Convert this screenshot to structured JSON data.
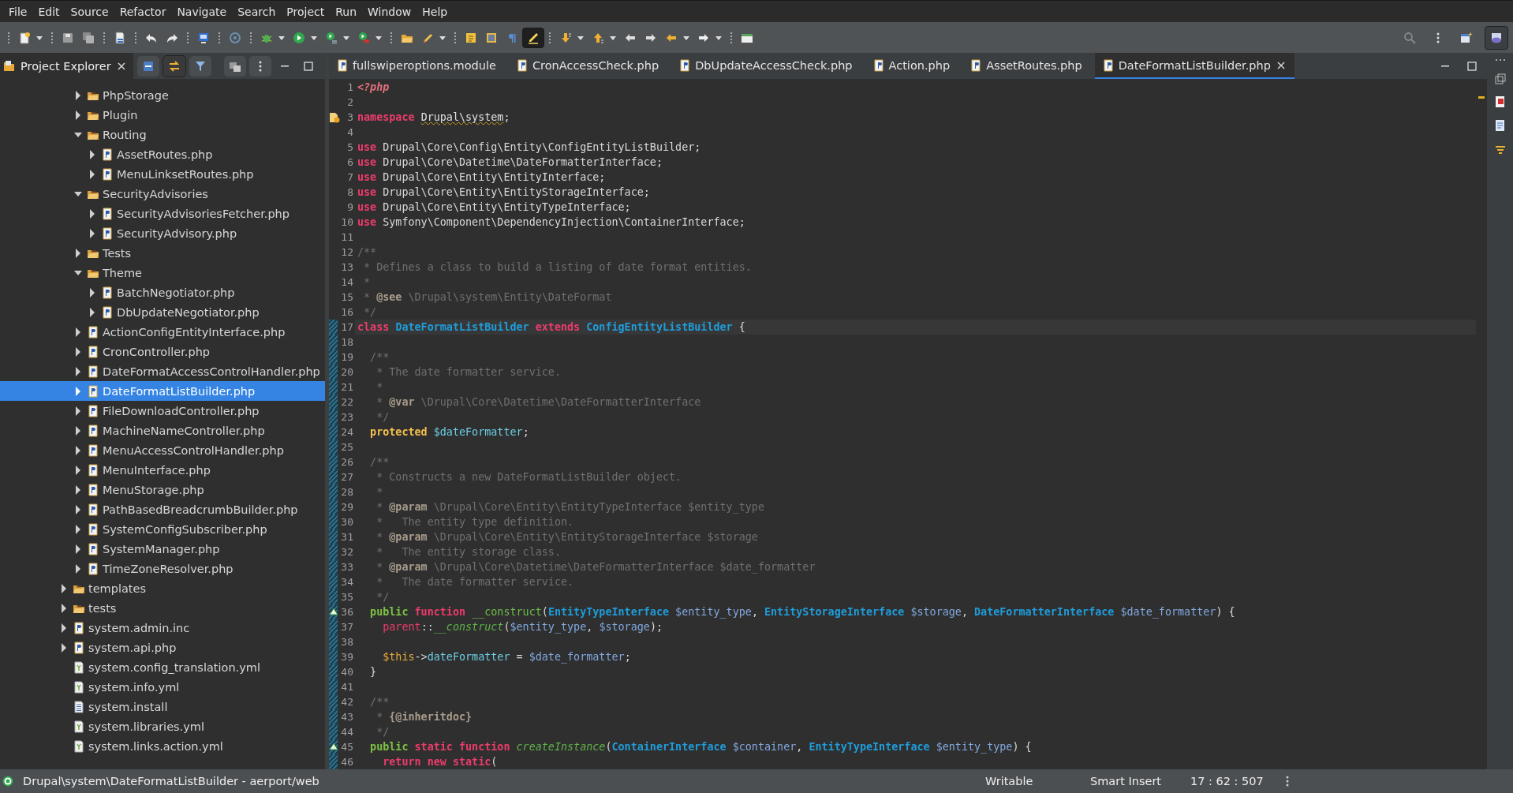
{
  "menu_bar": [
    "File",
    "Edit",
    "Source",
    "Refactor",
    "Navigate",
    "Search",
    "Project",
    "Run",
    "Window",
    "Help"
  ],
  "toolbar": {
    "groups": [
      [
        {
          "dropdown": true,
          "pressed": false
        }
      ],
      [
        {
          "dropdown": false,
          "pressed": false
        },
        {
          "dropdown": false,
          "pressed": false
        }
      ],
      [
        {
          "dropdown": false,
          "pressed": false
        }
      ],
      [
        {
          "dropdown": false,
          "pressed": false
        },
        {
          "dropdown": false,
          "pressed": false
        }
      ],
      [
        {
          "dropdown": false,
          "pressed": false
        }
      ],
      [
        {
          "dropdown": false,
          "pressed": false
        }
      ],
      [
        {
          "dropdown": true,
          "pressed": false
        },
        {
          "dropdown": true,
          "pressed": false
        },
        {
          "dropdown": true,
          "pressed": false
        },
        {
          "dropdown": true,
          "pressed": false
        }
      ],
      [
        {
          "dropdown": false,
          "pressed": false
        },
        {
          "dropdown": true,
          "pressed": false
        }
      ],
      [
        {
          "dropdown": false,
          "pressed": false
        },
        {
          "dropdown": false,
          "pressed": false
        },
        {
          "dropdown": false,
          "pressed": false
        },
        {
          "dropdown": false,
          "pressed": true
        }
      ],
      [
        {
          "dropdown": true,
          "pressed": false
        },
        {
          "dropdown": true,
          "pressed": false
        },
        {
          "dropdown": false,
          "pressed": false
        },
        {
          "dropdown": false,
          "pressed": false
        },
        {
          "dropdown": true,
          "pressed": false
        },
        {
          "dropdown": true,
          "pressed": false
        }
      ],
      [
        {
          "dropdown": false,
          "pressed": false
        }
      ]
    ],
    "right": [
      {
        "dropdown": false,
        "pressed": false
      },
      {
        "dropdown": false,
        "pressed": false
      },
      {
        "dropdown": false,
        "pressed": false
      },
      {
        "dropdown": false,
        "pressed": true
      }
    ]
  },
  "project_explorer": {
    "title": "Project Explorer",
    "tree": [
      {
        "children": [
          {
            "label": "PhpStorage",
            "kind": "package",
            "expanded": false,
            "selected": false
          },
          {
            "label": "Plugin",
            "kind": "package",
            "expanded": false,
            "selected": false
          },
          {
            "label": "Routing",
            "kind": "package",
            "expanded": true,
            "selected": false,
            "children": [
              {
                "label": "AssetRoutes.php",
                "kind": "php",
                "expanded": false,
                "selected": false
              },
              {
                "label": "MenuLinksetRoutes.php",
                "kind": "php",
                "expanded": false,
                "selected": false
              }
            ]
          },
          {
            "label": "SecurityAdvisories",
            "kind": "package",
            "expanded": true,
            "selected": false,
            "children": [
              {
                "label": "SecurityAdvisoriesFetcher.php",
                "kind": "php",
                "expanded": false,
                "selected": false
              },
              {
                "label": "SecurityAdvisory.php",
                "kind": "php",
                "expanded": false,
                "selected": false
              }
            ]
          },
          {
            "label": "Tests",
            "kind": "package",
            "expanded": false,
            "selected": false
          },
          {
            "label": "Theme",
            "kind": "package",
            "expanded": true,
            "selected": false,
            "children": [
              {
                "label": "BatchNegotiator.php",
                "kind": "php",
                "expanded": false,
                "selected": false
              },
              {
                "label": "DbUpdateNegotiator.php",
                "kind": "php",
                "expanded": false,
                "selected": false
              }
            ]
          },
          {
            "label": "ActionConfigEntityInterface.php",
            "kind": "php",
            "expanded": false,
            "selected": false
          },
          {
            "label": "CronController.php",
            "kind": "php",
            "expanded": false,
            "selected": false
          },
          {
            "label": "DateFormatAccessControlHandler.php",
            "kind": "php",
            "expanded": false,
            "selected": false
          },
          {
            "label": "DateFormatListBuilder.php",
            "kind": "php",
            "expanded": false,
            "selected": true
          },
          {
            "label": "FileDownloadController.php",
            "kind": "php",
            "expanded": false,
            "selected": false
          },
          {
            "label": "MachineNameController.php",
            "kind": "php",
            "expanded": false,
            "selected": false
          },
          {
            "label": "MenuAccessControlHandler.php",
            "kind": "php",
            "expanded": false,
            "selected": false
          },
          {
            "label": "MenuInterface.php",
            "kind": "php",
            "expanded": false,
            "selected": false
          },
          {
            "label": "MenuStorage.php",
            "kind": "php",
            "expanded": false,
            "selected": false
          },
          {
            "label": "PathBasedBreadcrumbBuilder.php",
            "kind": "php",
            "expanded": false,
            "selected": false
          },
          {
            "label": "SystemConfigSubscriber.php",
            "kind": "php",
            "expanded": false,
            "selected": false
          },
          {
            "label": "SystemManager.php",
            "kind": "php",
            "expanded": false,
            "selected": false
          },
          {
            "label": "TimeZoneResolver.php",
            "kind": "php",
            "expanded": false,
            "selected": false
          }
        ]
      },
      {
        "label": "templates",
        "kind": "package",
        "expanded": false,
        "selected": false
      },
      {
        "label": "tests",
        "kind": "package",
        "expanded": false,
        "selected": false
      },
      {
        "label": "system.admin.inc",
        "kind": "php",
        "expanded": false,
        "selected": false
      },
      {
        "label": "system.api.php",
        "kind": "php",
        "expanded": false,
        "selected": false
      },
      {
        "label": "system.config_translation.yml",
        "kind": "yml",
        "selected": false
      },
      {
        "label": "system.info.yml",
        "kind": "yml",
        "selected": false
      },
      {
        "label": "system.install",
        "kind": "text",
        "selected": false
      },
      {
        "label": "system.libraries.yml",
        "kind": "yml",
        "selected": false
      },
      {
        "label": "system.links.action.yml",
        "kind": "yml",
        "selected": false
      }
    ]
  },
  "editor": {
    "tabs": [
      {
        "label": "fullswiperoptions.module",
        "selected": false
      },
      {
        "label": "CronAccessCheck.php",
        "selected": false
      },
      {
        "label": "DbUpdateAccessCheck.php",
        "selected": false
      },
      {
        "label": "Action.php",
        "selected": false
      },
      {
        "label": "AssetRoutes.php",
        "selected": false
      },
      {
        "label": "DateFormatListBuilder.php",
        "selected": true
      }
    ],
    "lines": [
      {
        "number": "1",
        "tokens": [
          {
            "kind": "php-tag",
            "text": "<?php"
          }
        ]
      },
      {
        "number": "2"
      },
      {
        "number": "3",
        "warning": true,
        "tokens": [
          {
            "kind": "keyword",
            "text": "namespace "
          },
          {
            "kind": "namespace",
            "text": "Drupal\\system"
          },
          {
            "kind": "plain",
            "text": ";"
          }
        ]
      },
      {
        "number": "4"
      },
      {
        "number": "5",
        "tokens": [
          {
            "kind": "keyword",
            "text": "use"
          },
          {
            "kind": "plain",
            "text": " Drupal\\Core\\Config\\Entity\\ConfigEntityListBuilder;"
          }
        ]
      },
      {
        "number": "6",
        "tokens": [
          {
            "kind": "keyword",
            "text": "use"
          },
          {
            "kind": "plain",
            "text": " Drupal\\Core\\Datetime\\DateFormatterInterface;"
          }
        ]
      },
      {
        "number": "7",
        "tokens": [
          {
            "kind": "keyword",
            "text": "use"
          },
          {
            "kind": "plain",
            "text": " Drupal\\Core\\Entity\\EntityInterface;"
          }
        ]
      },
      {
        "number": "8",
        "tokens": [
          {
            "kind": "keyword",
            "text": "use"
          },
          {
            "kind": "plain",
            "text": " Drupal\\Core\\Entity\\EntityStorageInterface;"
          }
        ]
      },
      {
        "number": "9",
        "tokens": [
          {
            "kind": "keyword",
            "text": "use"
          },
          {
            "kind": "plain",
            "text": " Drupal\\Core\\Entity\\EntityTypeInterface;"
          }
        ]
      },
      {
        "number": "10",
        "tokens": [
          {
            "kind": "keyword",
            "text": "use"
          },
          {
            "kind": "plain",
            "text": " Symfony\\Component\\DependencyInjection\\ContainerInterface;"
          }
        ]
      },
      {
        "number": "11"
      },
      {
        "number": "12",
        "tokens": [
          {
            "kind": "comment",
            "text": "/**"
          }
        ]
      },
      {
        "number": "13",
        "tokens": [
          {
            "kind": "comment",
            "text": " * Defines a class to build a listing of date format entities."
          }
        ]
      },
      {
        "number": "14",
        "tokens": [
          {
            "kind": "comment",
            "text": " *"
          }
        ]
      },
      {
        "number": "15",
        "tokens": [
          {
            "kind": "comment",
            "text": " * "
          },
          {
            "kind": "doc-tag",
            "text": "@see"
          },
          {
            "kind": "comment",
            "text": " \\Drupal\\system\\Entity\\DateFormat"
          }
        ]
      },
      {
        "number": "16",
        "tokens": [
          {
            "kind": "comment",
            "text": " */"
          }
        ]
      },
      {
        "number": "17",
        "current": true,
        "changed": true,
        "tokens": [
          {
            "kind": "keyword",
            "text": "class "
          },
          {
            "kind": "type",
            "text": "DateFormatListBuilder"
          },
          {
            "kind": "keyword",
            "text": " extends "
          },
          {
            "kind": "type",
            "text": "ConfigEntityListBuilder"
          },
          {
            "kind": "plain",
            "text": " {"
          }
        ]
      },
      {
        "number": "18",
        "changed": true
      },
      {
        "number": "19",
        "changed": true,
        "tokens": [
          {
            "kind": "comment",
            "text": "  /**"
          }
        ]
      },
      {
        "number": "20",
        "changed": true,
        "tokens": [
          {
            "kind": "comment",
            "text": "   * The date formatter service."
          }
        ]
      },
      {
        "number": "21",
        "changed": true,
        "tokens": [
          {
            "kind": "comment",
            "text": "   *"
          }
        ]
      },
      {
        "number": "22",
        "changed": true,
        "tokens": [
          {
            "kind": "comment",
            "text": "   * "
          },
          {
            "kind": "doc-tag",
            "text": "@var"
          },
          {
            "kind": "comment",
            "text": " \\Drupal\\Core\\Datetime\\DateFormatterInterface"
          }
        ]
      },
      {
        "number": "23",
        "changed": true,
        "tokens": [
          {
            "kind": "comment",
            "text": "   */"
          }
        ]
      },
      {
        "number": "24",
        "changed": true,
        "tokens": [
          {
            "kind": "storage",
            "text": "  protected "
          },
          {
            "kind": "field",
            "text": "$dateFormatter"
          },
          {
            "kind": "plain",
            "text": ";"
          }
        ]
      },
      {
        "number": "25",
        "changed": true
      },
      {
        "number": "26",
        "changed": true,
        "tokens": [
          {
            "kind": "comment",
            "text": "  /**"
          }
        ]
      },
      {
        "number": "27",
        "changed": true,
        "tokens": [
          {
            "kind": "comment",
            "text": "   * Constructs a new DateFormatListBuilder object."
          }
        ]
      },
      {
        "number": "28",
        "changed": true,
        "tokens": [
          {
            "kind": "comment",
            "text": "   *"
          }
        ]
      },
      {
        "number": "29",
        "changed": true,
        "tokens": [
          {
            "kind": "comment",
            "text": "   * "
          },
          {
            "kind": "doc-tag",
            "text": "@param"
          },
          {
            "kind": "comment",
            "text": " \\Drupal\\Core\\Entity\\EntityTypeInterface $entity_type"
          }
        ]
      },
      {
        "number": "30",
        "changed": true,
        "tokens": [
          {
            "kind": "comment",
            "text": "   *   The entity type definition."
          }
        ]
      },
      {
        "number": "31",
        "changed": true,
        "tokens": [
          {
            "kind": "comment",
            "text": "   * "
          },
          {
            "kind": "doc-tag",
            "text": "@param"
          },
          {
            "kind": "comment",
            "text": " \\Drupal\\Core\\Entity\\EntityStorageInterface $storage"
          }
        ]
      },
      {
        "number": "32",
        "changed": true,
        "tokens": [
          {
            "kind": "comment",
            "text": "   *   The entity storage class."
          }
        ]
      },
      {
        "number": "33",
        "changed": true,
        "tokens": [
          {
            "kind": "comment",
            "text": "   * "
          },
          {
            "kind": "doc-tag",
            "text": "@param"
          },
          {
            "kind": "comment",
            "text": " \\Drupal\\Core\\Datetime\\DateFormatterInterface $date_formatter"
          }
        ]
      },
      {
        "number": "34",
        "changed": true,
        "tokens": [
          {
            "kind": "comment",
            "text": "   *   The date formatter service."
          }
        ]
      },
      {
        "number": "35",
        "changed": true,
        "tokens": [
          {
            "kind": "comment",
            "text": "   */"
          }
        ]
      },
      {
        "number": "36",
        "changed": true,
        "overridden": true,
        "tokens": [
          {
            "kind": "modifier",
            "text": "  public "
          },
          {
            "kind": "keyword",
            "text": "function "
          },
          {
            "kind": "function",
            "text": "__construct"
          },
          {
            "kind": "plain",
            "text": "("
          },
          {
            "kind": "type",
            "text": "EntityTypeInterface"
          },
          {
            "kind": "variable",
            "text": " $entity_type"
          },
          {
            "kind": "plain",
            "text": ", "
          },
          {
            "kind": "type",
            "text": "EntityStorageInterface"
          },
          {
            "kind": "variable",
            "text": " $storage"
          },
          {
            "kind": "plain",
            "text": ", "
          },
          {
            "kind": "type",
            "text": "DateFormatterInterface"
          },
          {
            "kind": "variable",
            "text": " $date_formatter"
          },
          {
            "kind": "plain",
            "text": ") {"
          }
        ]
      },
      {
        "number": "37",
        "changed": true,
        "tokens": [
          {
            "kind": "keyword-light",
            "text": "    parent"
          },
          {
            "kind": "plain",
            "text": "::"
          },
          {
            "kind": "method-call",
            "text": "__construct"
          },
          {
            "kind": "plain",
            "text": "("
          },
          {
            "kind": "variable",
            "text": "$entity_type"
          },
          {
            "kind": "plain",
            "text": ", "
          },
          {
            "kind": "variable",
            "text": "$storage"
          },
          {
            "kind": "plain",
            "text": ");"
          }
        ]
      },
      {
        "number": "38",
        "changed": true
      },
      {
        "number": "39",
        "changed": true,
        "tokens": [
          {
            "kind": "this",
            "text": "    $this"
          },
          {
            "kind": "plain",
            "text": "->"
          },
          {
            "kind": "field",
            "text": "dateFormatter"
          },
          {
            "kind": "plain",
            "text": " = "
          },
          {
            "kind": "variable",
            "text": "$date_formatter"
          },
          {
            "kind": "plain",
            "text": ";"
          }
        ]
      },
      {
        "number": "40",
        "changed": true,
        "tokens": [
          {
            "kind": "plain",
            "text": "  }"
          }
        ]
      },
      {
        "number": "41",
        "changed": true
      },
      {
        "number": "42",
        "changed": true,
        "tokens": [
          {
            "kind": "comment",
            "text": "  /**"
          }
        ]
      },
      {
        "number": "43",
        "changed": true,
        "tokens": [
          {
            "kind": "comment",
            "text": "   * "
          },
          {
            "kind": "doc-tag",
            "text": "{@inheritdoc}"
          }
        ]
      },
      {
        "number": "44",
        "changed": true,
        "tokens": [
          {
            "kind": "comment",
            "text": "   */"
          }
        ]
      },
      {
        "number": "45",
        "changed": true,
        "overridden": true,
        "tokens": [
          {
            "kind": "modifier",
            "text": "  public "
          },
          {
            "kind": "keyword",
            "text": "static function "
          },
          {
            "kind": "method-call",
            "text": "createInstance"
          },
          {
            "kind": "plain",
            "text": "("
          },
          {
            "kind": "type",
            "text": "ContainerInterface"
          },
          {
            "kind": "variable",
            "text": " $container"
          },
          {
            "kind": "plain",
            "text": ", "
          },
          {
            "kind": "type",
            "text": "EntityTypeInterface"
          },
          {
            "kind": "variable",
            "text": " $entity_type"
          },
          {
            "kind": "plain",
            "text": ") {"
          }
        ]
      },
      {
        "number": "46",
        "changed": true,
        "tokens": [
          {
            "kind": "keyword",
            "text": "    return new static"
          },
          {
            "kind": "plain",
            "text": "("
          }
        ]
      }
    ]
  },
  "status_bar": {
    "path": "Drupal\\system\\DateFormatListBuilder - aerport/web",
    "mode": "Writable",
    "insert_mode": "Smart Insert",
    "position": "17 : 62 : 507"
  }
}
